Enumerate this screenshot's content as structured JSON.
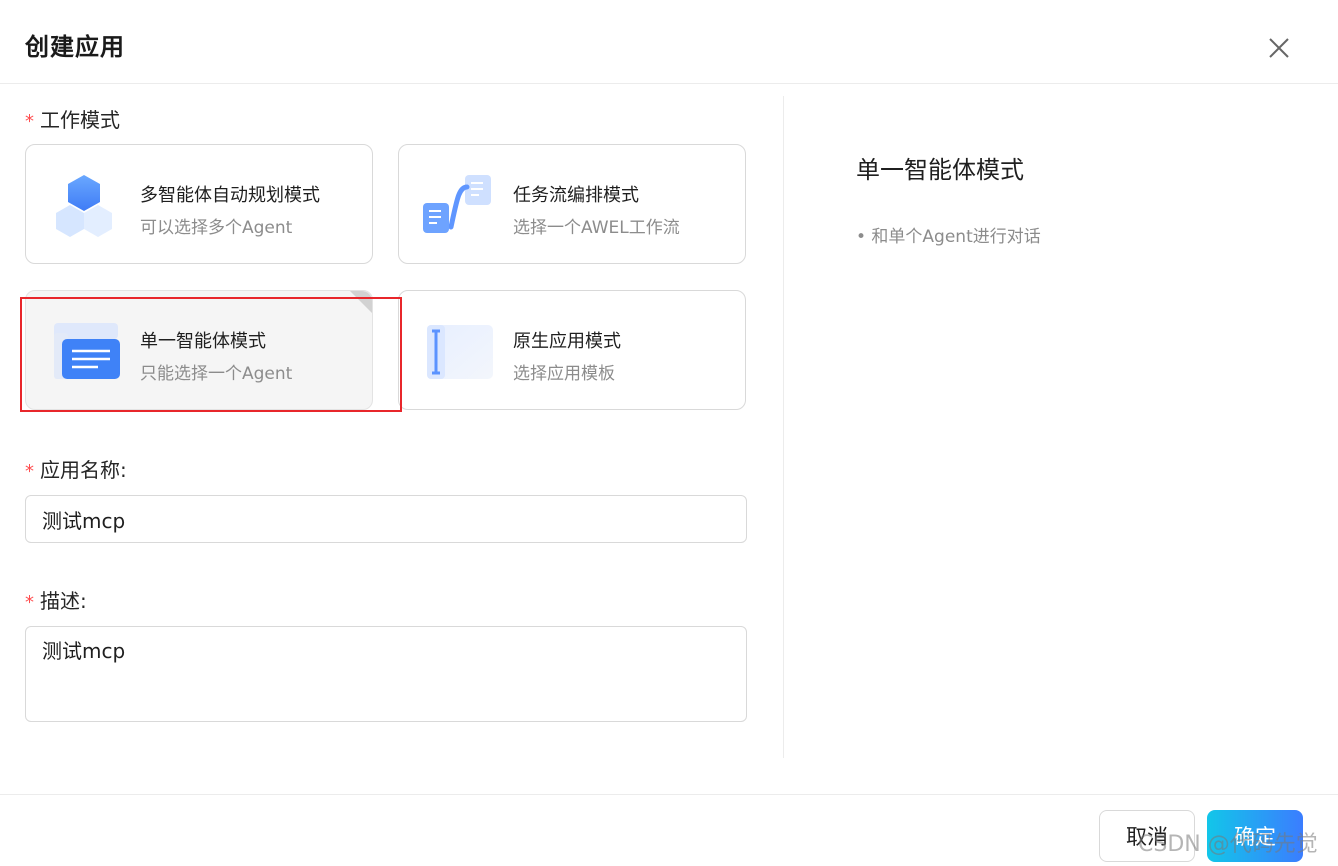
{
  "dialog": {
    "title": "创建应用",
    "close_icon": "close-icon"
  },
  "form": {
    "work_mode_label": "工作模式",
    "required_mark": "*",
    "modes": [
      {
        "title": "多智能体自动规划模式",
        "desc": "可以选择多个Agent",
        "icon": "hexagon-stack-icon",
        "selected": false
      },
      {
        "title": "任务流编排模式",
        "desc": "选择一个AWEL工作流",
        "icon": "workflow-icon",
        "selected": false
      },
      {
        "title": "单一智能体模式",
        "desc": "只能选择一个Agent",
        "icon": "single-agent-icon",
        "selected": true
      },
      {
        "title": "原生应用模式",
        "desc": "选择应用模板",
        "icon": "native-app-icon",
        "selected": false
      }
    ],
    "name_label": "应用名称:",
    "name_value": "测试mcp",
    "desc_label": "描述:",
    "desc_value": "测试mcp"
  },
  "info_panel": {
    "title": "单一智能体模式",
    "bullet": "• 和单个Agent进行对话"
  },
  "footer": {
    "cancel_label": "取消",
    "ok_label": "确定"
  },
  "watermark": "CSDN @代码先觉",
  "colors": {
    "required": "#ff4d4f",
    "highlight": "#e8262b",
    "ok_gradient_start": "#12c6e9",
    "ok_gradient_end": "#3b7dff"
  }
}
